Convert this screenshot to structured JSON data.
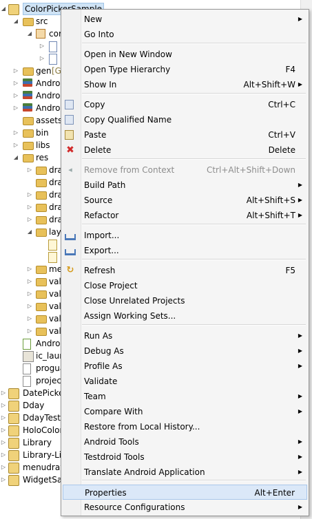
{
  "tree": {
    "rows": [
      {
        "label": "ColorPickerSample",
        "selected": true
      },
      {
        "label": "src"
      },
      {
        "label": "cor"
      },
      {
        "label": ""
      },
      {
        "label": ""
      },
      {
        "label": "gen",
        "decoration": "[G"
      },
      {
        "label": "Androi"
      },
      {
        "label": "Androi"
      },
      {
        "label": "Androi"
      },
      {
        "label": "assets"
      },
      {
        "label": "bin"
      },
      {
        "label": "libs"
      },
      {
        "label": "res"
      },
      {
        "label": "dra"
      },
      {
        "label": "dra"
      },
      {
        "label": "dra"
      },
      {
        "label": "dra"
      },
      {
        "label": "dra"
      },
      {
        "label": "lay"
      },
      {
        "label": ""
      },
      {
        "label": ""
      },
      {
        "label": "me"
      },
      {
        "label": "val"
      },
      {
        "label": "val"
      },
      {
        "label": "val"
      },
      {
        "label": "val"
      },
      {
        "label": "val"
      },
      {
        "label": "Androi"
      },
      {
        "label": "ic_laur"
      },
      {
        "label": "progua"
      },
      {
        "label": "project"
      },
      {
        "label": "DatePicke"
      },
      {
        "label": "Dday"
      },
      {
        "label": "DdayTest"
      },
      {
        "label": "HoloColor"
      },
      {
        "label": "Library"
      },
      {
        "label": "Library-Lis"
      },
      {
        "label": "menudraw"
      },
      {
        "label": "WidgetSar"
      }
    ]
  },
  "menu": {
    "items": [
      {
        "label": "New",
        "submenu": true
      },
      {
        "label": "Go Into"
      },
      {
        "label": "Open in New Window"
      },
      {
        "label": "Open Type Hierarchy",
        "shortcut": "F4"
      },
      {
        "label": "Show In",
        "shortcut": "Alt+Shift+W",
        "submenu": true
      },
      {
        "label": "Copy",
        "shortcut": "Ctrl+C",
        "icon": "copy-icon"
      },
      {
        "label": "Copy Qualified Name",
        "icon": "copy-qualified-name-icon"
      },
      {
        "label": "Paste",
        "shortcut": "Ctrl+V",
        "icon": "paste-icon"
      },
      {
        "label": "Delete",
        "shortcut": "Delete",
        "icon": "delete-icon"
      },
      {
        "label": "Remove from Context",
        "shortcut": "Ctrl+Alt+Shift+Down",
        "disabled": true,
        "icon": "remove-from-context-icon"
      },
      {
        "label": "Build Path",
        "submenu": true
      },
      {
        "label": "Source",
        "shortcut": "Alt+Shift+S",
        "submenu": true
      },
      {
        "label": "Refactor",
        "shortcut": "Alt+Shift+T",
        "submenu": true
      },
      {
        "label": "Import...",
        "icon": "import-icon"
      },
      {
        "label": "Export...",
        "icon": "export-icon"
      },
      {
        "label": "Refresh",
        "shortcut": "F5",
        "icon": "refresh-icon"
      },
      {
        "label": "Close Project"
      },
      {
        "label": "Close Unrelated Projects"
      },
      {
        "label": "Assign Working Sets..."
      },
      {
        "label": "Run As",
        "submenu": true
      },
      {
        "label": "Debug As",
        "submenu": true
      },
      {
        "label": "Profile As",
        "submenu": true
      },
      {
        "label": "Validate"
      },
      {
        "label": "Team",
        "submenu": true
      },
      {
        "label": "Compare With",
        "submenu": true
      },
      {
        "label": "Restore from Local History..."
      },
      {
        "label": "Android Tools",
        "submenu": true
      },
      {
        "label": "Testdroid Tools",
        "submenu": true
      },
      {
        "label": "Translate Android Application",
        "submenu": true
      },
      {
        "label": "Properties",
        "shortcut": "Alt+Enter",
        "highlighted": true
      },
      {
        "label": "Resource Configurations",
        "submenu": true
      }
    ]
  }
}
